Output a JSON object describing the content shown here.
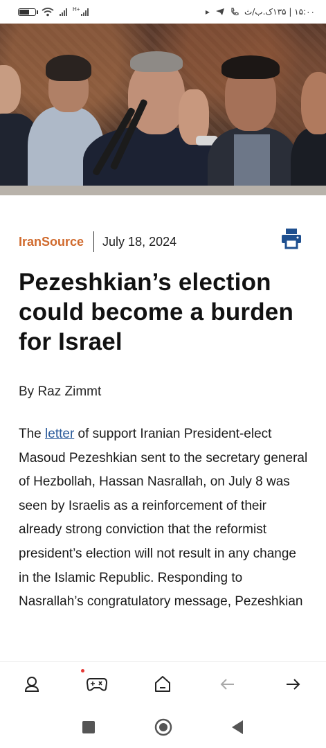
{
  "status_bar": {
    "time_text": "۱۵:۰۰ | ۱۳۵ک.ب/ث",
    "network_label": "H+",
    "icons": [
      "battery-icon",
      "wifi-icon",
      "signal-icon",
      "signal-icon",
      "play-icon",
      "telegram-icon",
      "call-icon"
    ]
  },
  "article": {
    "source": "IranSource",
    "date": "July 18, 2024",
    "title": "Pezeshkian’s election could become a burden for Israel",
    "byline_prefix": "By ",
    "author": "Raz Zimmt",
    "body_before_link": "The ",
    "link_text": "letter",
    "body_after_link": " of support Iranian President-elect Masoud Pezeshkian sent to the secretary general of Hezbollah, Hassan Nasrallah, on July 8 was seen by Israelis as a reinforcement of their already strong conviction that the reformist president’s election will not result in any change in the Islamic Republic. Responding to Nasrallah’s congratulatory message, Pezeshkian",
    "accent_color": "#d06a2d",
    "link_color": "#2a5a9a"
  },
  "toolbar": {
    "items": [
      "profile-icon",
      "game-icon",
      "home-icon",
      "back-arrow-icon",
      "forward-arrow-icon"
    ]
  },
  "navbar": {
    "items": [
      "recents-square-icon",
      "home-circle-icon",
      "back-triangle-icon"
    ]
  }
}
